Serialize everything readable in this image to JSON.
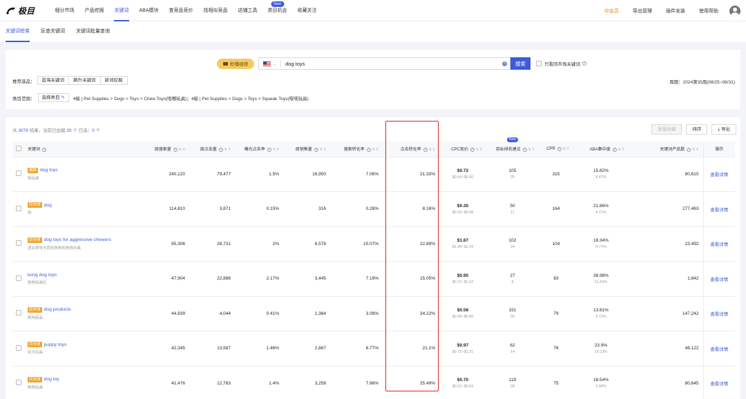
{
  "app": {
    "logo_text": "极目",
    "nav": [
      {
        "label": "细分市场",
        "active": false,
        "badge": ""
      },
      {
        "label": "产品挖掘",
        "active": false,
        "badge": ""
      },
      {
        "label": "关键词",
        "active": true,
        "badge": ""
      },
      {
        "label": "ABA模块",
        "active": false,
        "badge": ""
      },
      {
        "label": "查竞品竞价",
        "active": false,
        "badge": ""
      },
      {
        "label": "找相似竞品",
        "active": false,
        "badge": ""
      },
      {
        "label": "店铺工具",
        "active": false,
        "badge": ""
      },
      {
        "label": "类目机会",
        "active": false,
        "badge": "New"
      },
      {
        "label": "收藏关注",
        "active": false,
        "badge": ""
      }
    ],
    "nav_right": {
      "member": "中会员",
      "export_mgmt": "导出管理",
      "plugin": "插件安装",
      "help": "使用帮助"
    }
  },
  "subtabs": [
    "关键词榜单",
    "反查关键词",
    "关键词批量查询"
  ],
  "search": {
    "video_label": "秒懂视频",
    "query": "dog toys",
    "button": "搜索",
    "same_market_label": "只看同市场关键词"
  },
  "recommend": {
    "label": "推荐选品：",
    "options": [
      "蓝海关键词",
      "飙升关键词",
      "新词挖掘"
    ]
  },
  "week": "周期：2024第35周(08/25~08/31)",
  "category": {
    "label": "类目范围：",
    "select": "选择类目",
    "text": "4级 | Pet Supplies > Dogs > Toys > Chew Toys(咀嚼玩具)；4级 | Pet Supplies > Dogs > Toys > Squeak Toys(吱吱玩具)"
  },
  "results": {
    "summary_prefix": "共 ",
    "total": "3079",
    "summary_mid": " 结果，当前已加载 ",
    "loaded": "20",
    "summary_mid2": " 个   已选：",
    "selected": "0",
    "summary_suffix": " 个",
    "batch_btn": "批量收藏",
    "sort_btn": "排序",
    "export_btn": "导出"
  },
  "table": {
    "headers": [
      "关键词",
      "周搜索量",
      "周点击量",
      "曝光点击率",
      "周销售量",
      "搜索转化率",
      "点击转化率",
      "CPC竞价",
      "目标排名建议",
      "CPR",
      "ABA集中度",
      "关键词产品数",
      "操作"
    ],
    "new_badge": "New",
    "rows": [
      {
        "tag": "爆款",
        "kw": "dog toys",
        "cn": "狗玩具",
        "search": "240,120",
        "click": "79,477",
        "ctr": "1.5%",
        "sales": "16,950",
        "scr": "7.06%",
        "ccr": "21.33%",
        "cpc": "$0.72",
        "cpc_range": "$0.54~$0.90",
        "rank": "105",
        "rank_sub": "25",
        "cpr": "315",
        "aba": "15.82%",
        "aba_sub": "8.47%",
        "products": "80,610",
        "action": "查看详情"
      },
      {
        "tag": "同市场",
        "kw": "dog",
        "cn": "狗",
        "search": "114,810",
        "click": "3,871",
        "ctr": "0.15%",
        "sales": "316",
        "scr": "0.28%",
        "ccr": "8.16%",
        "cpc": "$0.35",
        "cpc_range": "$0.32~$0.38",
        "rank": "50",
        "rank_sub": "11",
        "cpr": "164",
        "aba": "21.86%",
        "aba_sub": "4.71%",
        "products": "277,463",
        "action": "查看详情"
      },
      {
        "tag": "同市场",
        "kw": "dog toys for aggressive chewers",
        "cn": "适合爱咬东西的狗狗的狗狗玩具",
        "search": "65,306",
        "click": "28,731",
        "ctr": "2%",
        "sales": "6,578",
        "scr": "10.07%",
        "ccr": "22.89%",
        "cpc": "$1.87",
        "cpc_range": "$1.40~$2.34",
        "rank": "102",
        "rank_sub": "24",
        "cpr": "104",
        "aba": "18.34%",
        "aba_sub": "4.77%",
        "products": "23,492",
        "action": "查看详情"
      },
      {
        "tag": "",
        "kw": "kong dog toys",
        "cn": "狗狗玩具礼",
        "search": "47,904",
        "click": "22,888",
        "ctr": "2.17%",
        "sales": "3,445",
        "scr": "7.19%",
        "ccr": "15.05%",
        "cpc": "$0.95",
        "cpc_range": "$0.72~$1.22",
        "rank": "27",
        "rank_sub": "6",
        "cpr": "83",
        "aba": "38.98%",
        "aba_sub": "21.52%",
        "products": "1,842",
        "action": "查看详情"
      },
      {
        "tag": "同市场",
        "kw": "dog products",
        "cn": "狗狗用品",
        "search": "44,939",
        "click": "4,044",
        "ctr": "0.41%",
        "sales": "1,384",
        "scr": "3.08%",
        "ccr": "34.22%",
        "cpc": "$0.58",
        "cpc_range": "$0.45~$0.65",
        "rank": "151",
        "rank_sub": "36",
        "cpr": "79",
        "aba": "13.81%",
        "aba_sub": "9.72%",
        "products": "147,242",
        "action": "查看详情"
      },
      {
        "tag": "同市场",
        "kw": "puppy toys",
        "cn": "幼犬玩具",
        "search": "42,345",
        "click": "13,587",
        "ctr": "1.46%",
        "sales": "2,867",
        "scr": "6.77%",
        "ccr": "21.1%",
        "cpc": "$0.97",
        "cpc_range": "$0.73~$1.21",
        "rank": "62",
        "rank_sub": "14",
        "cpr": "76",
        "aba": "23.9%",
        "aba_sub": "16.13%",
        "products": "48,122",
        "action": "查看详情"
      },
      {
        "tag": "同市场",
        "kw": "dog toy",
        "cn": "狗狗玩具",
        "search": "41,476",
        "click": "12,783",
        "ctr": "1.4%",
        "sales": "3,258",
        "scr": "7.86%",
        "ccr": "25.49%",
        "cpc": "$0.70",
        "cpc_range": "$0.52~$0.93",
        "rank": "119",
        "rank_sub": "28",
        "cpr": "75",
        "aba": "16.54%",
        "aba_sub": "9.98%",
        "products": "80,645",
        "action": "查看详情"
      }
    ]
  }
}
